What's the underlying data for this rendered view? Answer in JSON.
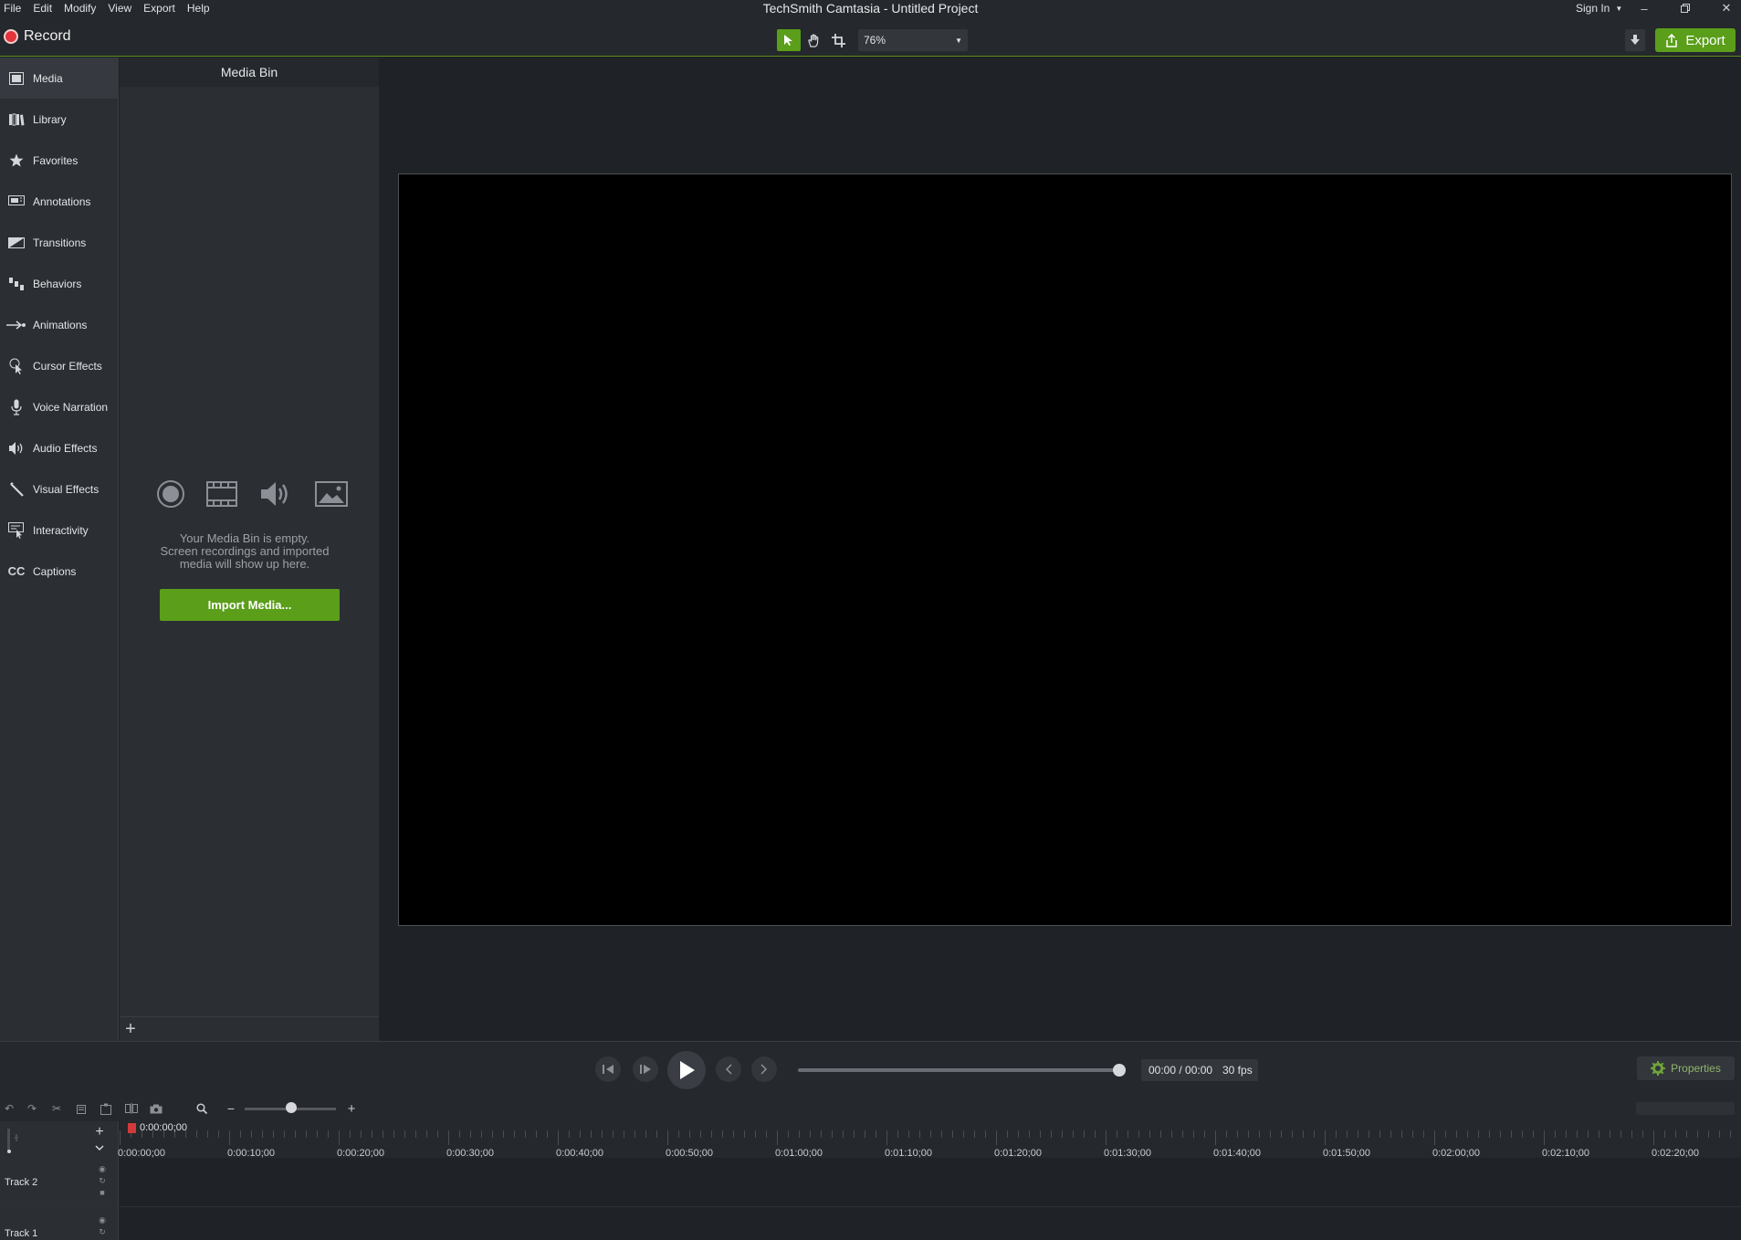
{
  "window": {
    "title": "TechSmith Camtasia - Untitled Project",
    "sign_in": "Sign In",
    "minimize": "–",
    "restore": "❐",
    "close": "✕"
  },
  "menu": [
    "File",
    "Edit",
    "Modify",
    "View",
    "Export",
    "Help"
  ],
  "toolbar": {
    "record_label": "Record",
    "zoom_value": "76%",
    "export_label": "Export",
    "accent_color": "#5a9e1a",
    "record_color": "#e2343a"
  },
  "sidebar": {
    "items": [
      {
        "label": "Media",
        "icon": "film-icon",
        "active": true
      },
      {
        "label": "Library",
        "icon": "books-icon"
      },
      {
        "label": "Favorites",
        "icon": "star-icon"
      },
      {
        "label": "Annotations",
        "icon": "annotation-icon"
      },
      {
        "label": "Transitions",
        "icon": "transition-icon"
      },
      {
        "label": "Behaviors",
        "icon": "behaviors-icon"
      },
      {
        "label": "Animations",
        "icon": "animation-arrow-icon"
      },
      {
        "label": "Cursor Effects",
        "icon": "cursor-icon"
      },
      {
        "label": "Voice Narration",
        "icon": "microphone-icon"
      },
      {
        "label": "Audio Effects",
        "icon": "speaker-icon"
      },
      {
        "label": "Visual Effects",
        "icon": "magic-wand-icon"
      },
      {
        "label": "Interactivity",
        "icon": "interactivity-icon"
      },
      {
        "label": "Captions",
        "icon": "cc-icon"
      }
    ]
  },
  "media_bin": {
    "title": "Media Bin",
    "empty_line1": "Your Media Bin is empty.",
    "empty_line2": "Screen recordings and imported",
    "empty_line3": "media will show up here.",
    "import_label": "Import Media...",
    "add_label": "+"
  },
  "playback": {
    "time": "00:00 / 00:00",
    "fps": "30 fps",
    "properties_label": "Properties",
    "scrub_position": 1.0
  },
  "timeline": {
    "playhead_time": "0:00:00;00",
    "zoom_level": 0.5,
    "ruler_labels": [
      "0:00:00;00",
      "0:00:10;00",
      "0:00:20;00",
      "0:00:30;00",
      "0:00:40;00",
      "0:00:50;00",
      "0:01:00;00",
      "0:01:10;00",
      "0:01:20;00",
      "0:01:30;00",
      "0:01:40;00",
      "0:01:50;00",
      "0:02:00;00",
      "0:02:10;00",
      "0:02:20;00"
    ],
    "tracks": [
      "Track 2",
      "Track 1"
    ],
    "add_track": "+",
    "collapse": "⌄"
  }
}
